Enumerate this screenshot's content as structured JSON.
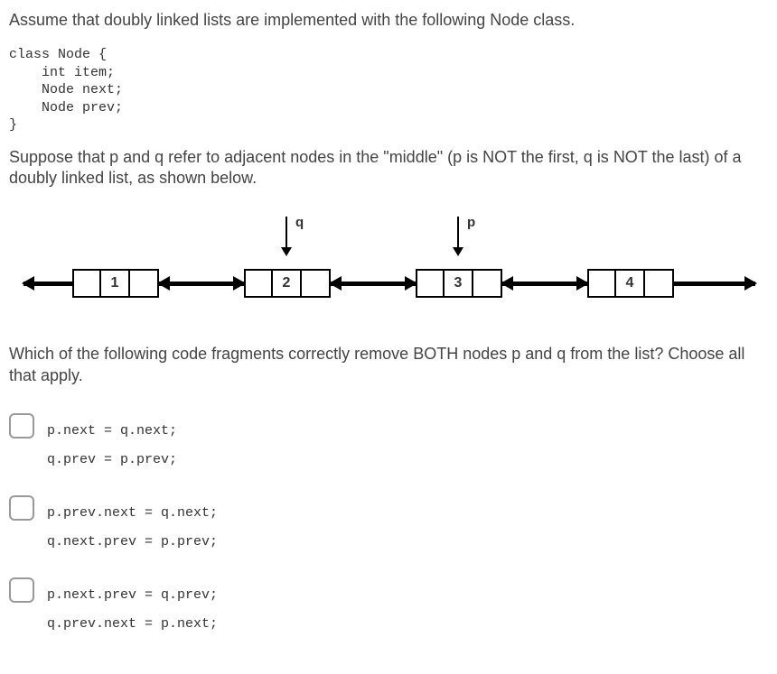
{
  "intro": "Assume that doubly linked lists are implemented with the following Node class.",
  "code": "class Node {\n    int item;\n    Node next;\n    Node prev;\n}",
  "body1": "Suppose that p and q refer to adjacent nodes in the \"middle\" (p is NOT the first, q is NOT the last) of a doubly linked list, as shown below.",
  "diagram": {
    "ptr_q": "q",
    "ptr_p": "p",
    "node1": "1",
    "node2": "2",
    "node3": "3",
    "node4": "4"
  },
  "question": "Which of the following code fragments correctly remove BOTH nodes p and q from the list?  Choose all that apply.",
  "options": [
    "p.next = q.next;\nq.prev = p.prev;",
    "p.prev.next = q.next;\nq.next.prev = p.prev;",
    "p.next.prev = q.prev;\nq.prev.next = p.next;"
  ]
}
